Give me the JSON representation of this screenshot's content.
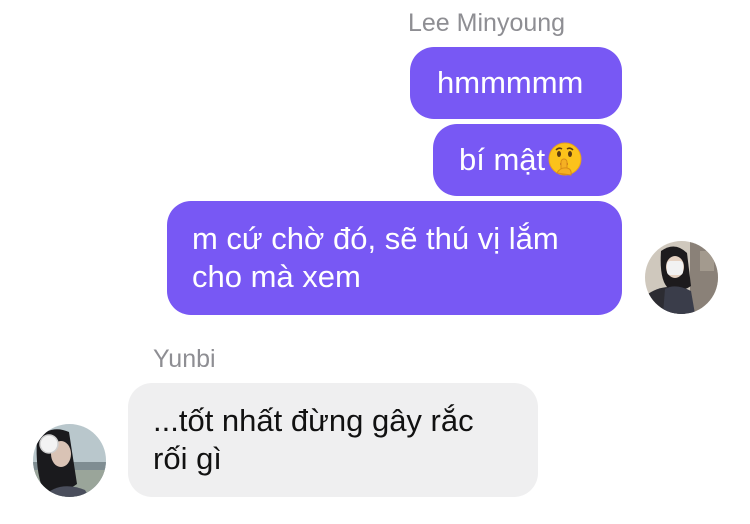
{
  "conversation": {
    "outgoing_sender": "Lee Minyoung",
    "incoming_sender": "Yunbi",
    "messages": [
      {
        "from": "Lee Minyoung",
        "text": "hmmmmm"
      },
      {
        "from": "Lee Minyoung",
        "text": "bí mật",
        "emoji": "shushing-face-icon"
      },
      {
        "from": "Lee Minyoung",
        "lines": [
          "m cứ chờ đó, sẽ thú vị lắm",
          "cho mà xem"
        ]
      },
      {
        "from": "Yunbi",
        "lines": [
          "...tốt nhất đừng gây rắc",
          "rối gì"
        ]
      }
    ]
  },
  "colors": {
    "outgoing_bubble": "#7858f4",
    "incoming_bubble": "#efeff0",
    "sender_name": "#8e8e93"
  }
}
